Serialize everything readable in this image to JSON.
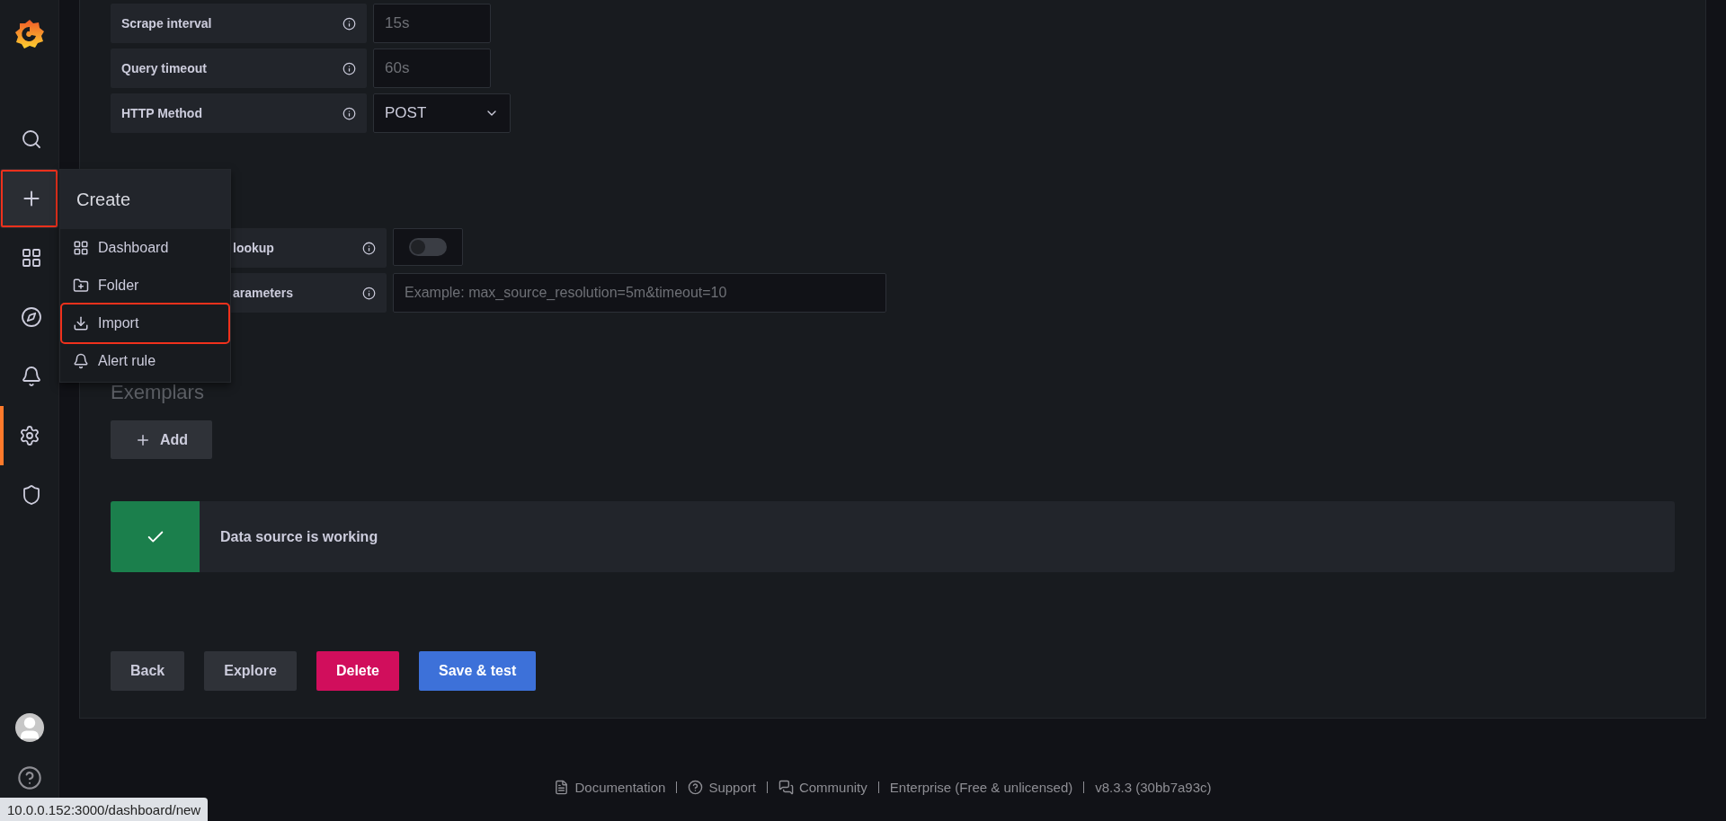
{
  "sidebar": {
    "items": [
      {
        "selected": false,
        "highlighted": false
      },
      {
        "selected": false,
        "highlighted": true
      },
      {
        "selected": false,
        "highlighted": false
      },
      {
        "selected": false,
        "highlighted": false
      },
      {
        "selected": false,
        "highlighted": false
      },
      {
        "selected": true,
        "highlighted": false
      },
      {
        "selected": false,
        "highlighted": false
      }
    ]
  },
  "create_menu": {
    "title": "Create",
    "items": [
      {
        "label": "Dashboard",
        "highlighted": false
      },
      {
        "label": "Folder",
        "highlighted": false
      },
      {
        "label": "Import",
        "highlighted": true
      },
      {
        "label": "Alert rule",
        "highlighted": false
      }
    ]
  },
  "settings": {
    "rows": [
      {
        "label": "Scrape interval",
        "kind": "input",
        "placeholder": "15s"
      },
      {
        "label": "Query timeout",
        "kind": "input",
        "placeholder": "60s"
      },
      {
        "label": "HTTP Method",
        "kind": "select",
        "value": "POST"
      }
    ]
  },
  "misc": {
    "rows": [
      {
        "label": "lookup",
        "kind": "toggle",
        "on": false
      },
      {
        "label": "arameters",
        "kind": "input",
        "placeholder": "Example: max_source_resolution=5m&timeout=10"
      }
    ]
  },
  "exemplars": {
    "title": "Exemplars",
    "add_button": "Add"
  },
  "alert": {
    "kind": "success",
    "message": "Data source is working"
  },
  "buttons": [
    {
      "label": "Back",
      "kind": "secondary"
    },
    {
      "label": "Explore",
      "kind": "secondary"
    },
    {
      "label": "Delete",
      "kind": "destructive"
    },
    {
      "label": "Save & test",
      "kind": "primary"
    }
  ],
  "footer": {
    "links": [
      {
        "label": "Documentation",
        "kind": "docs"
      },
      {
        "label": "Support",
        "kind": "support"
      },
      {
        "label": "Community",
        "kind": "community"
      },
      {
        "label": "Enterprise (Free & unlicensed)",
        "kind": "text"
      },
      {
        "label": "v8.3.3 (30bb7a93c)",
        "kind": "text"
      }
    ]
  },
  "status_bar": {
    "url": "10.0.0.152:3000/dashboard/new"
  }
}
